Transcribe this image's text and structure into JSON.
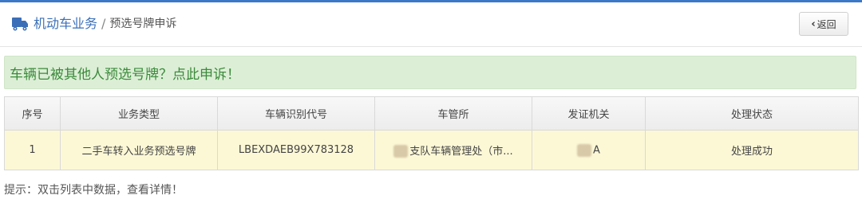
{
  "header": {
    "breadcrumb_root": "机动车业务",
    "separator": "/",
    "breadcrumb_current": "预选号牌申诉",
    "back_label": "返回",
    "truck_icon": "truck-icon"
  },
  "alert": {
    "text": "车辆已被其他人预选号牌？点此申诉！"
  },
  "table": {
    "columns": [
      "序号",
      "业务类型",
      "车辆识别代号",
      "车管所",
      "发证机关",
      "处理状态"
    ],
    "rows": [
      {
        "seq": "1",
        "business_type": "二手车转入业务预选号牌",
        "vin": "LBEXDAEB99X783128",
        "office": "支队车辆管理处（市...",
        "issuer": "A",
        "status": "处理成功"
      }
    ]
  },
  "hint": "提示：双击列表中数据，查看详情！",
  "colors": {
    "accent": "#3a6fb8",
    "alert_bg": "#dcefd6",
    "alert_text": "#3c8a3c",
    "row_highlight": "#fcf8d6"
  }
}
